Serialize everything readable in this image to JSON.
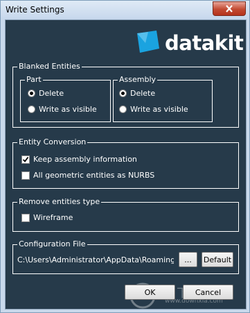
{
  "window": {
    "title": "Write Settings"
  },
  "logo": {
    "text": "datakit",
    "mark_color": "#1aa3e0"
  },
  "blanked_entities": {
    "legend": "Blanked Entities",
    "part": {
      "legend": "Part",
      "delete": "Delete",
      "write_visible": "Write as visible",
      "selected": "delete"
    },
    "assembly": {
      "legend": "Assembly",
      "delete": "Delete",
      "write_visible": "Write as visible",
      "selected": "delete"
    }
  },
  "entity_conversion": {
    "legend": "Entity Conversion",
    "keep_assembly": {
      "label": "Keep assembly information",
      "checked": true
    },
    "nurbs": {
      "label": "All geometric entities as NURBS",
      "checked": false
    }
  },
  "remove_entities": {
    "legend": "Remove entities type",
    "wireframe": {
      "label": "Wireframe",
      "checked": false
    }
  },
  "configuration": {
    "legend": "Configuration File",
    "path": "C:\\Users\\Administrator\\AppData\\Roaming\\Data",
    "browse_label": "...",
    "default_label": "Default"
  },
  "buttons": {
    "ok": "OK",
    "cancel": "Cancel"
  },
  "watermark": {
    "text": "当下软件园",
    "sub": "www.downxia.com"
  }
}
